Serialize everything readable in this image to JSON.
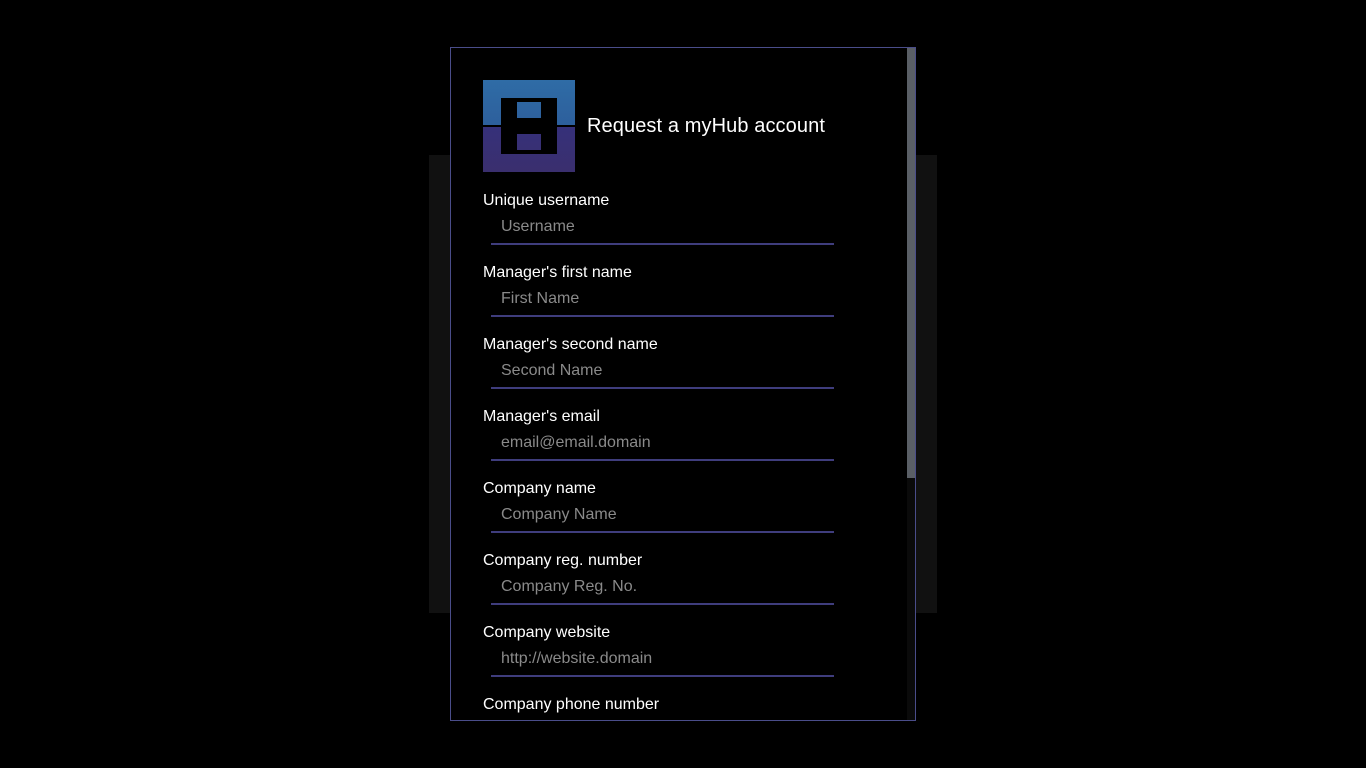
{
  "colors": {
    "background": "#000000",
    "dialog_border": "#4a4d8a",
    "input_underline": "#3f3d7d",
    "logo_top": "#2d6aa3",
    "logo_bottom": "#393071",
    "scrollbar_thumb": "#5a5f66"
  },
  "header": {
    "logo_icon": "myhub-h-logo",
    "title": "Request a myHub account"
  },
  "form": {
    "fields": [
      {
        "label": "Unique username",
        "placeholder": "Username",
        "value": ""
      },
      {
        "label": "Manager's first name",
        "placeholder": "First Name",
        "value": ""
      },
      {
        "label": "Manager's second name",
        "placeholder": "Second Name",
        "value": ""
      },
      {
        "label": "Manager's email",
        "placeholder": "email@email.domain",
        "value": ""
      },
      {
        "label": "Company name",
        "placeholder": "Company Name",
        "value": ""
      },
      {
        "label": "Company reg. number",
        "placeholder": "Company Reg. No.",
        "value": ""
      },
      {
        "label": "Company website",
        "placeholder": "http://website.domain",
        "value": ""
      },
      {
        "label": "Company phone number",
        "placeholder": "",
        "value": ""
      }
    ]
  }
}
